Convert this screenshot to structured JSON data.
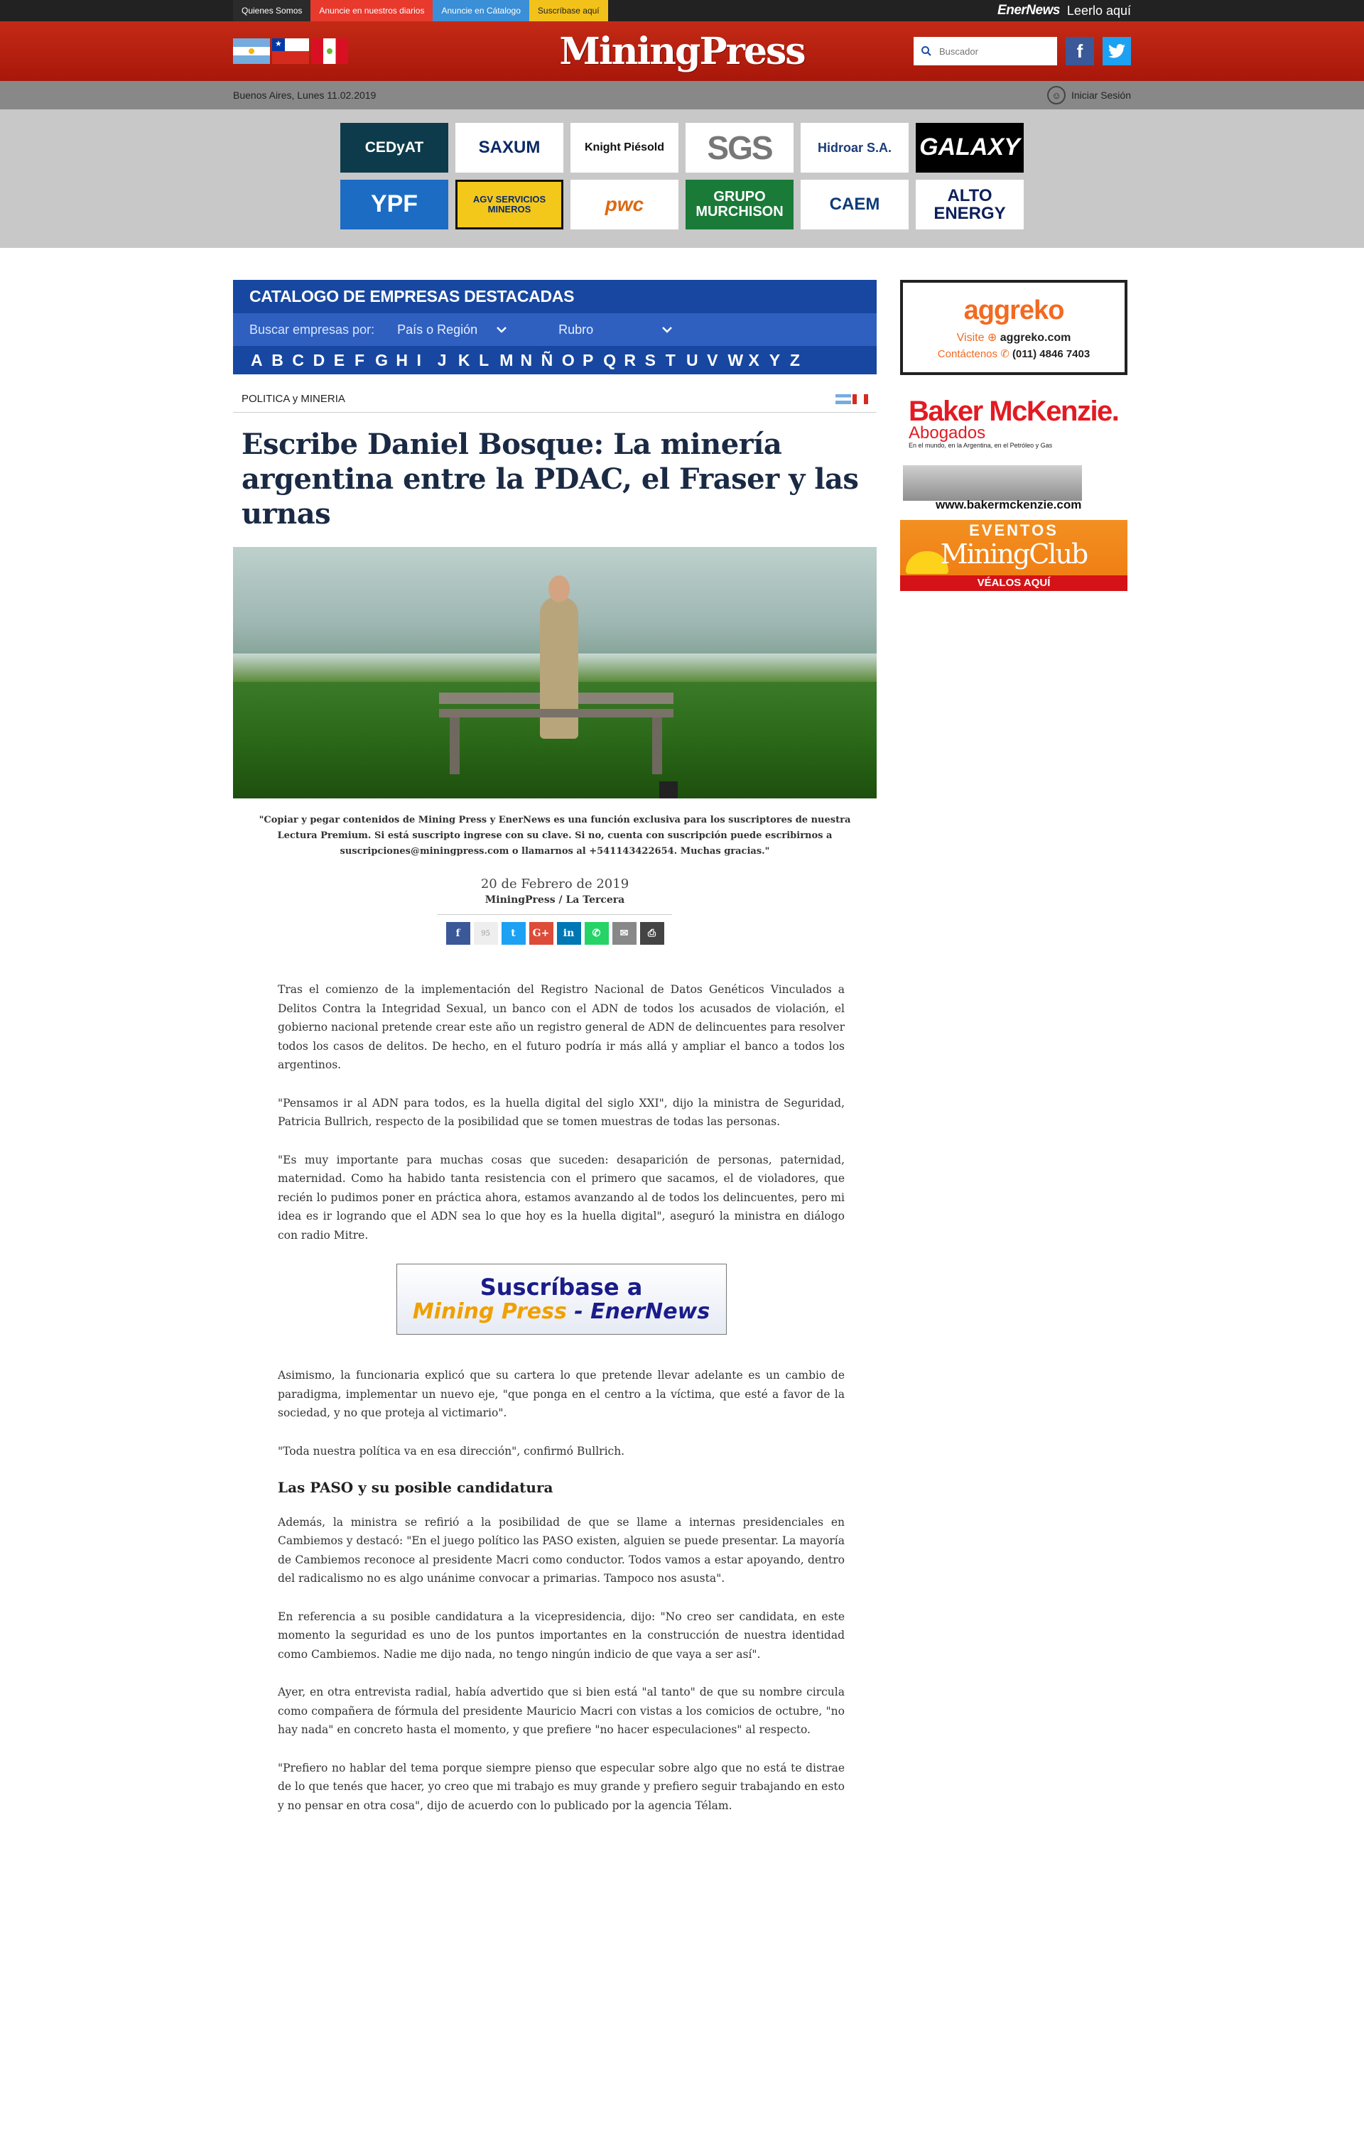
{
  "topbar": {
    "links": [
      "Quienes Somos",
      "Anuncie en nuestros diarios",
      "Anuncie en Cátalogo",
      "Suscríbase aquí"
    ],
    "enernews_brand": "EnerNews",
    "enernews_cta": "Leerlo aquí"
  },
  "header": {
    "logo": "MiningPress",
    "search_placeholder": "Buscador",
    "facebook": "f",
    "twitter": "t"
  },
  "datebar": {
    "date": "Buenos Aires, Lunes 11.02.2019",
    "login": "Iniciar Sesión"
  },
  "sponsors": [
    "CEDyAT",
    "SAXUM",
    "Knight Piésold",
    "SGS",
    "Hidroar S.A.",
    "GALAXY",
    "YPF",
    "AGV SERVICIOS MINEROS",
    "pwc",
    "GRUPO MURCHISON",
    "CAEM",
    "ALTO ENERGY"
  ],
  "catalog": {
    "title": "CATALOGO DE EMPRESAS DESTACADAS",
    "filter_label": "Buscar empresas por:",
    "filter_country": "País o Región",
    "filter_rubro": "Rubro",
    "letters": [
      "A",
      "B",
      "C",
      "D",
      "E",
      "F",
      "G",
      "H",
      "I",
      "J",
      "K",
      "L",
      "M",
      "N",
      "Ñ",
      "O",
      "P",
      "Q",
      "R",
      "S",
      "T",
      "U",
      "V",
      "W",
      "X",
      "Y",
      "Z"
    ]
  },
  "article": {
    "section": "POLITICA y MINERIA",
    "title": "Escribe Daniel Bosque: La minería argentina entre la PDAC, el Fraser y las urnas",
    "notice": "\"Copiar y pegar contenidos de Mining Press y EnerNews es una función exclusiva para los suscriptores de nuestra Lectura Premium. Si está suscripto ingrese con su clave. Si no, cuenta con suscripción puede escribirnos a suscripciones@miningpress.com o llamarnos al +541143422654. Muchas gracias.\"",
    "date": "20 de Febrero de 2019",
    "source": "MiningPress / La Tercera",
    "share_count": "95",
    "paragraphs_1": [
      "Tras el comienzo de la implementación del Registro Nacional de Datos Genéticos Vinculados a Delitos Contra la Integridad Sexual, un banco con el ADN de todos los acusados de violación, el gobierno nacional pretende crear este año un registro general de ADN de delincuentes para resolver todos los casos de delitos. De hecho, en el futuro podría ir más allá y ampliar el banco a todos los argentinos.",
      "\"Pensamos ir al ADN para todos, es la huella digital del siglo XXI\", dijo la ministra de Seguridad, Patricia Bullrich, respecto de la posibilidad que se tomen muestras de todas las personas.",
      "\"Es muy importante para muchas cosas que suceden: desaparición de personas, paternidad, maternidad. Como ha habido tanta resistencia con el primero que sacamos, el de violadores, que recién lo pudimos poner en práctica ahora, estamos avanzando al de todos los delincuentes, pero mi idea es ir logrando que el ADN sea lo que hoy es la huella digital\", aseguró la ministra en diálogo con radio Mitre."
    ],
    "subscribe_line1": "Suscríbase a",
    "subscribe_mining": "Mining Press",
    "subscribe_rest": " - EnerNews",
    "paragraphs_2": [
      "Asimismo, la funcionaria explicó que su cartera lo que pretende llevar adelante es un cambio de paradigma, implementar un nuevo eje, \"que ponga en el centro a la víctima, que esté a favor de la sociedad, y no que proteja al victimario\".",
      "\"Toda nuestra política va en esa dirección\", confirmó Bullrich."
    ],
    "subheading": "Las PASO y su posible candidatura",
    "paragraphs_3": [
      "Además, la ministra se refirió a la posibilidad de que se llame a internas presidenciales en Cambiemos y destacó: \"En el juego político las PASO existen, alguien se puede presentar. La mayoría de Cambiemos reconoce al presidente Macri como conductor. Todos vamos a estar apoyando, dentro del radicalismo no es algo unánime convocar a primarias. Tampoco nos asusta\".",
      "En referencia a su posible candidatura a la vicepresidencia, dijo: \"No creo ser candidata, en este momento la seguridad es uno de los puntos importantes en la construcción de nuestra identidad como Cambiemos. Nadie me dijo nada, no tengo ningún indicio de que vaya a ser así\".",
      "Ayer, en otra entrevista radial, había advertido que si bien está \"al tanto\" de que su nombre circula como compañera de fórmula del presidente Mauricio Macri con vistas a los comicios de octubre, \"no hay nada\" en concreto hasta el momento, y que prefiere \"no hacer especulaciones\" al respecto.",
      "\"Prefiero no hablar del tema porque siempre pienso que especular sobre algo que no está te distrae de lo que tenés que hacer, yo creo que mi trabajo es muy grande y prefiero seguir trabajando en esto y no pensar en otra cosa\", dijo de acuerdo con lo publicado por la agencia Télam."
    ]
  },
  "sidebar": {
    "aggreko_brand": "aggreko",
    "aggreko_visit": "Visite",
    "aggreko_url": "aggreko.com",
    "aggreko_contact": "Contáctenos",
    "aggreko_phone": "(011) 4846 7403",
    "baker_name": "Baker McKenzie.",
    "baker_sub": "Abogados",
    "baker_tag": "En el mundo, en la Argentina, en el Petróleo y Gas",
    "baker_url": "www.bakermckenzie.com",
    "events_title": "EVENTOS",
    "events_brand": "MiningClub",
    "events_cta": "VÉALOS AQUÍ"
  }
}
